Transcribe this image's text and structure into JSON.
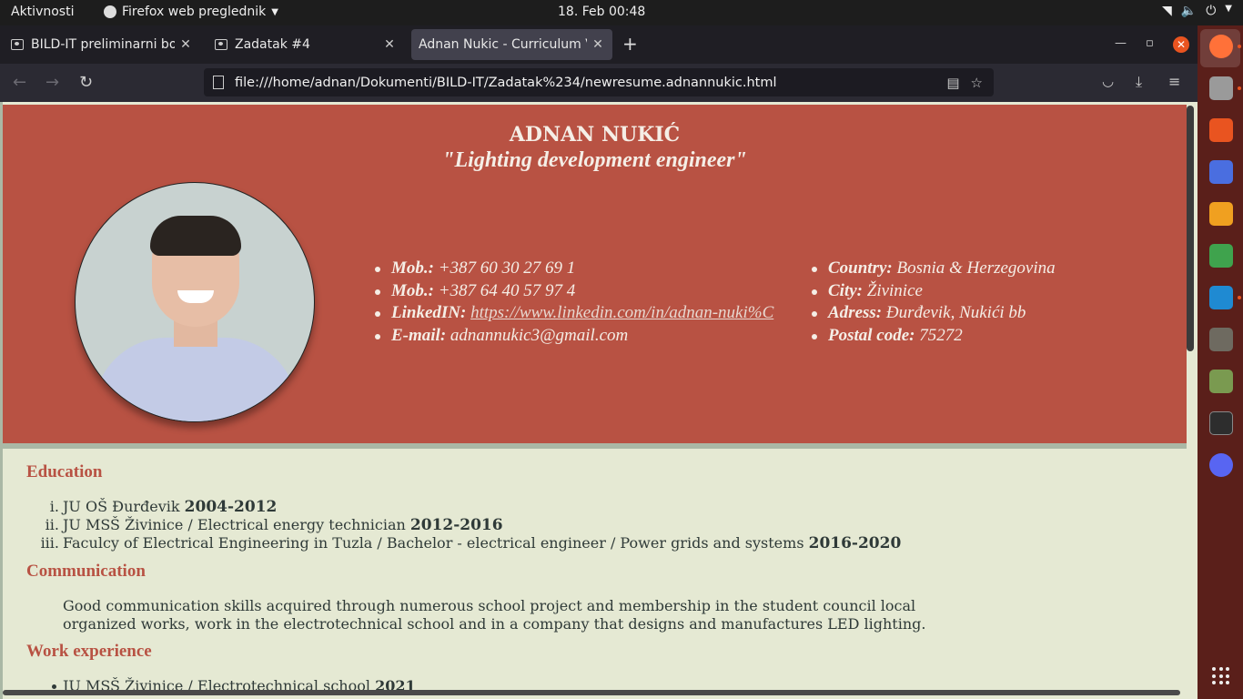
{
  "topbar": {
    "activities": "Aktivnosti",
    "app_name": "Firefox web preglednik",
    "clock": "18. Feb  00:48",
    "tray_icons": [
      "wifi-icon",
      "volume-icon",
      "power-icon",
      "chevron-down-icon"
    ]
  },
  "tabs": [
    {
      "label": "BILD-IT preliminarni boot",
      "active": false
    },
    {
      "label": "Zadatak #4",
      "active": false
    },
    {
      "label": "Adnan Nukic - Curriculum Vitae",
      "active": true
    }
  ],
  "navbar": {
    "url": "file:///home/adnan/Dokumenti/BILD-IT/Zadatak%234/newresume.adnannukic.html"
  },
  "resume": {
    "name": "ADNAN NUKIĆ",
    "subtitle": "\"Lighting development engineer\"",
    "contact_left": [
      {
        "label": "Mob.:",
        "value": "+387 60 30 27 69 1"
      },
      {
        "label": "Mob.:",
        "value": "+387 64 40 57 97 4"
      },
      {
        "label": "LinkedIN:",
        "value": "https://www.linkedin.com/in/adnan-nuki%C"
      },
      {
        "label": "E-mail:",
        "value": "adnannukic3@gmail.com"
      }
    ],
    "contact_right": [
      {
        "label": "Country:",
        "value": "Bosnia & Herzegovina"
      },
      {
        "label": "City:",
        "value": "Živinice"
      },
      {
        "label": "Adress:",
        "value": "Đurđevik, Nukići bb"
      },
      {
        "label": "Postal code:",
        "value": "75272"
      }
    ],
    "education_title": "Education",
    "education": [
      {
        "num": "i.",
        "text": "JU OŠ Đurđevik ",
        "years": "2004-2012"
      },
      {
        "num": "ii.",
        "text": "JU MSŠ Živinice / Electrical energy technician ",
        "years": "2012-2016"
      },
      {
        "num": "iii.",
        "text": "Faculcy of Electrical Engineering in Tuzla / Bachelor - electrical engineer / Power grids and systems ",
        "years": "2016-2020"
      }
    ],
    "communication_title": "Communication",
    "communication_text": "Good communication skills acquired through numerous school project and membership in the student council local organized works, work in the electrotechnical school and in a company that designs and manufactures LED lighting.",
    "work_title": "Work experience",
    "work": [
      {
        "text": "JU MSŠ Živinice / Electrotechnical school ",
        "years": "2021"
      }
    ]
  },
  "colors": {
    "header_bg": "#b85243",
    "page_bg": "#e5e9d3",
    "section_title": "#b85243",
    "dock_bg": "#5a1f1a"
  }
}
